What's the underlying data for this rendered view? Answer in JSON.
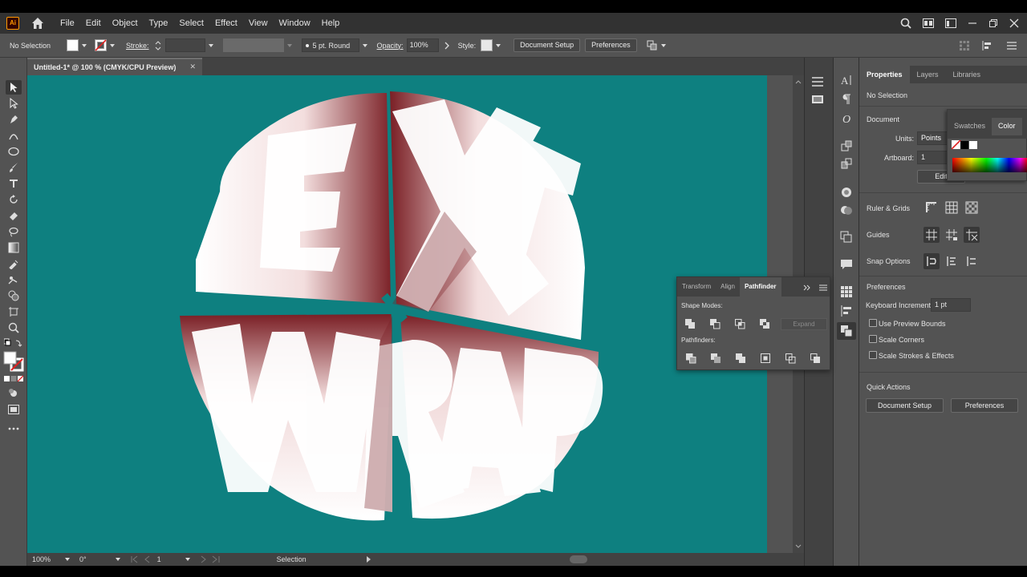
{
  "menu": {
    "logo": "Ai",
    "items": [
      "File",
      "Edit",
      "Object",
      "Type",
      "Select",
      "Effect",
      "View",
      "Window",
      "Help"
    ]
  },
  "control_bar": {
    "selection_label": "No Selection",
    "stroke_label": "Stroke:",
    "brush_label": "5 pt. Round",
    "opacity_label": "Opacity:",
    "opacity_value": "100%",
    "style_label": "Style:",
    "document_setup": "Document Setup",
    "preferences": "Preferences"
  },
  "document_tab": {
    "title": "Untitled-1* @ 100 % (CMYK/CPU Preview)",
    "close": "✕"
  },
  "artwork": {
    "letters_top": [
      "E",
      "X",
      "T"
    ],
    "letters_bottom": [
      "W",
      "R",
      "A",
      "P"
    ],
    "background": "#0e8080"
  },
  "status_bar": {
    "zoom": "100%",
    "rotation": "0°",
    "artboard": "1",
    "tool": "Selection"
  },
  "properties": {
    "tabs": [
      "Properties",
      "Layers",
      "Libraries"
    ],
    "no_selection": "No Selection",
    "document_header": "Document",
    "units_label": "Units:",
    "units_value": "Points",
    "artboard_label": "Artboard:",
    "artboard_value": "1",
    "edit_button": "Edit",
    "ruler_grids": "Ruler & Grids",
    "guides": "Guides",
    "snap_options": "Snap Options",
    "preferences_header": "Preferences",
    "keyboard_increment_label": "Keyboard Increment:",
    "keyboard_increment_value": "1 pt",
    "use_preview_bounds": "Use Preview Bounds",
    "scale_corners": "Scale Corners",
    "scale_strokes": "Scale Strokes & Effects",
    "quick_actions": "Quick Actions",
    "document_setup": "Document Setup",
    "preferences": "Preferences"
  },
  "color_popup": {
    "tabs": [
      "Swatches",
      "Color"
    ]
  },
  "pathfinder": {
    "tabs": [
      "Transform",
      "Align",
      "Pathfinder"
    ],
    "shape_modes": "Shape Modes:",
    "expand": "Expand",
    "pathfinders": "Pathfinders:"
  },
  "colors": {
    "canvas": "#0e8080",
    "panel": "#535353",
    "dark_panel": "#424242",
    "menubar": "#323232",
    "accent_orange": "#ff9a00",
    "letter_shade": "#7a1f25"
  }
}
